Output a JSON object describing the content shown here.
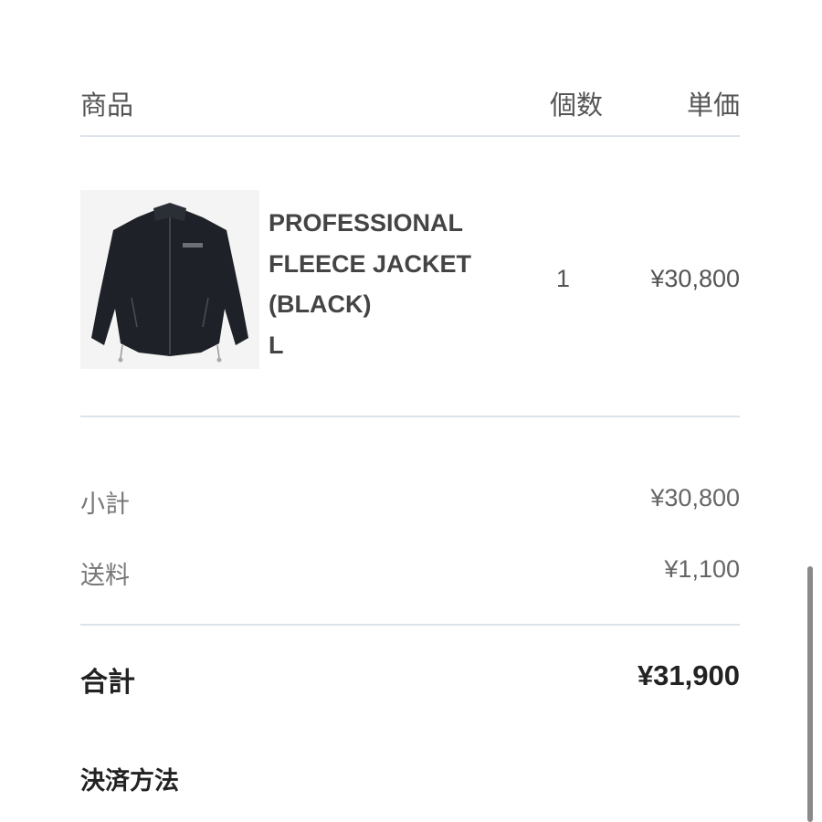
{
  "table_header": {
    "product": "商品",
    "quantity": "個数",
    "unit_price": "単価"
  },
  "item": {
    "image_icon": "black-fleece-jacket-photo",
    "name_lines": [
      "PROFESSIONAL",
      "FLEECE JACKET",
      "(BLACK)",
      "L"
    ],
    "quantity": "1",
    "price": "¥30,800"
  },
  "summary": {
    "subtotal_label": "小計",
    "subtotal_value": "¥30,800",
    "shipping_label": "送料",
    "shipping_value": "¥1,100",
    "total_label": "合計",
    "total_value": "¥31,900"
  },
  "payment": {
    "heading": "決済方法"
  },
  "colors": {
    "divider": "#dde3ea",
    "text_dark": "#222222",
    "text_muted": "#777777"
  }
}
